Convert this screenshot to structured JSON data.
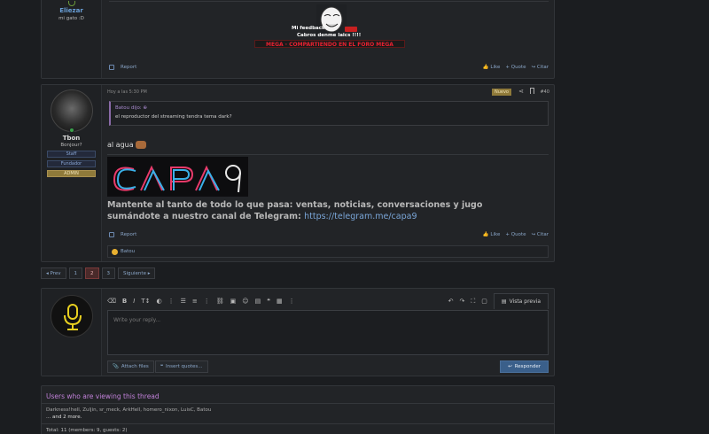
{
  "post1": {
    "username": "Eliezar",
    "user_title": "mi gato :D",
    "sig_feedback": "Mi feedback",
    "sig_subtitle": "Cabros denme laics !!!!",
    "sig_banner": "MEGA · COMPARTIENDO EN EL FORO MEGA",
    "report": "Report",
    "like": "Like",
    "quote": "Quote",
    "cite": "Citar"
  },
  "post2": {
    "username": "Tbon",
    "user_title": "Bonjour?",
    "badges": [
      "Staff",
      "Fundador",
      "ADMIN"
    ],
    "timestamp": "Hoy a las 5:30 PM",
    "new_badge": "Nuevo",
    "post_number": "#40",
    "quote_author": "Batou dijo:",
    "quote_text": "el reproductor del streaming tendra tema dark?",
    "message": "al agua",
    "logo_text": "CAPA9",
    "promo_text": "Mantente al tanto de todo lo que pasa: ventas, noticias, conversaciones y jugo sumándote a nuestro canal de Telegram:",
    "promo_link": "https://telegram.me/capa9",
    "report": "Report",
    "like": "Like",
    "quote": "Quote",
    "cite": "Citar",
    "reaction_user": "Batou"
  },
  "pager": {
    "prev": "◂ Prev",
    "pages": [
      "1",
      "2",
      "3"
    ],
    "current": "2",
    "next": "Siguiente ▸"
  },
  "reply": {
    "placeholder": "Write your reply...",
    "preview": "Vista previa",
    "attach": "Attach files",
    "insert_quotes": "Insert quotes...",
    "submit": "Responder"
  },
  "viewers": {
    "title": "Users who are viewing this thread",
    "users": "Darkness!hell, Zuljin, sr_meck, ArkHell, homero_nixon, LuisC, Batou",
    "more": "... and 2 more.",
    "total": "Total: 11 (members: 9, guests: 2)"
  },
  "colors": {
    "accent_link": "#8aa6c8",
    "quote_purple": "#a98bd0",
    "admin_gold": "#8f7a3a",
    "submit_blue": "#3a5f8a",
    "viewers_title": "#c080d8"
  }
}
